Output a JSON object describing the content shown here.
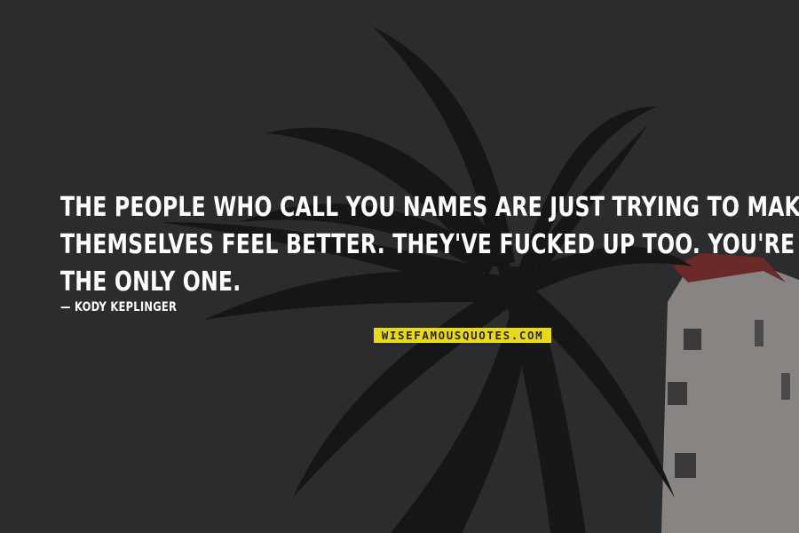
{
  "quote": {
    "lines": [
      "THE PEOPLE WHO CALL YOU NAMES ARE JUST TRYING TO MAKE",
      "THEMSELVES FEEL BETTER. THEY'VE FUCKED UP TOO. YOU'RE NOT",
      "THE ONLY ONE."
    ],
    "author": "— KODY KEPLINGER"
  },
  "logo": {
    "text": "WISEFAMOUSQUOTES.COM"
  },
  "colors": {
    "background": "#2b2c2d",
    "text": "#ffffff",
    "logo_bg": "#e9d81b",
    "logo_text": "#2a2b2c",
    "palm": "#141615",
    "lighthouse": "#8d8a87",
    "lighthouse_top": "#6e2b2b"
  }
}
